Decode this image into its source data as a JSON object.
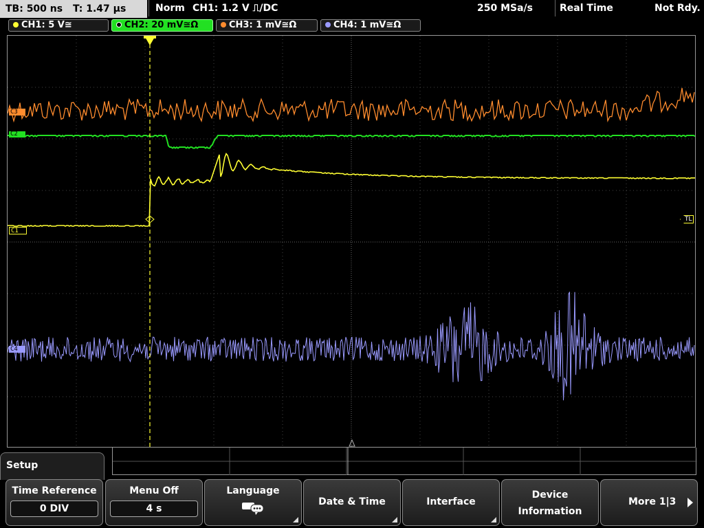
{
  "top": {
    "timebase": "TB: 500 ns",
    "trigger_time": "T: 1.47 µs",
    "mode": "Norm",
    "trigger": "CH1: 1.2 V ⎍/DC",
    "sample_rate": "250 MSa/s",
    "acq_mode": "Real Time",
    "status": "Not Rdy."
  },
  "channels": [
    {
      "label": "CH1: 5 V≅",
      "color": "#ffff33"
    },
    {
      "label": "CH2: 20 mV≅Ω",
      "color": "#22e022"
    },
    {
      "label": "CH3: 1 mV≅Ω",
      "color": "#ff8c2e"
    },
    {
      "label": "CH4: 1 mV≅Ω",
      "color": "#9a9aff"
    }
  ],
  "markers": {
    "c1": "C1",
    "tl": "TL",
    "c3": "C3",
    "c2": "C2",
    "c4": "C4"
  },
  "menu": {
    "title": "Setup",
    "softkeys": [
      {
        "label": "Time Reference",
        "value": "0 DIV"
      },
      {
        "label": "Menu Off",
        "value": "4 s"
      },
      {
        "label": "Language",
        "icon": "speech-bubble-icon"
      },
      {
        "label": "Date & Time"
      },
      {
        "label": "Interface"
      },
      {
        "label": "Device",
        "label2": "Information"
      },
      {
        "label": "More 1|3"
      }
    ]
  }
}
